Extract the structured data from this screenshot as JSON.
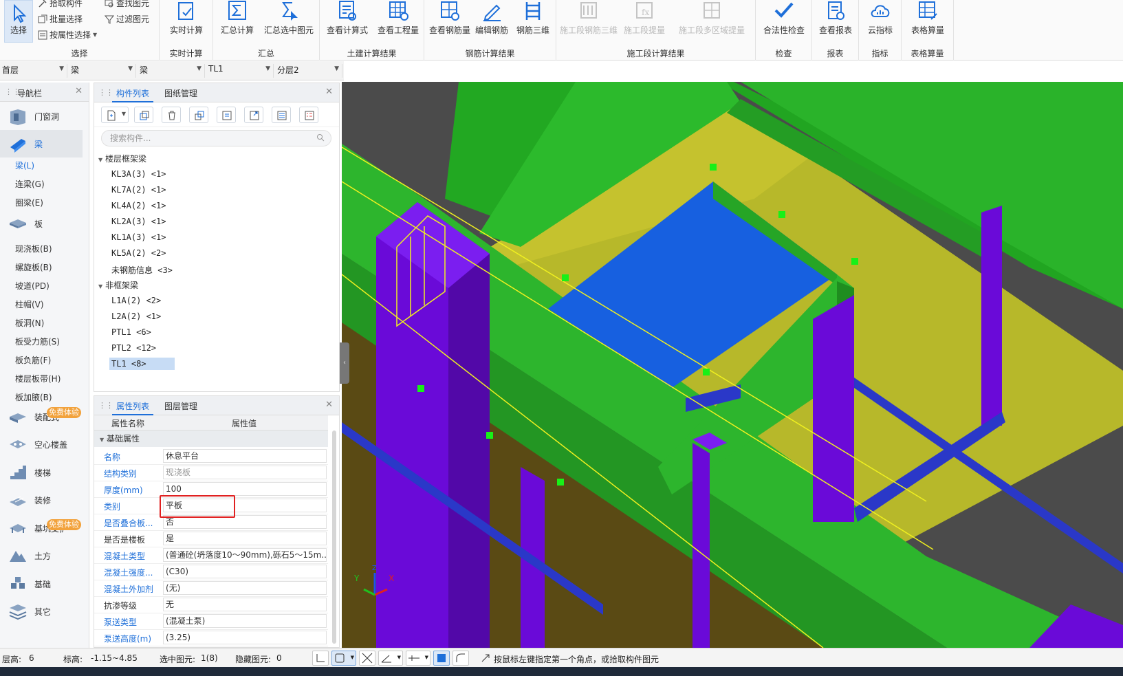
{
  "ribbon": {
    "select_group": {
      "select_label": "选择",
      "pick_label": "拾取构件",
      "batch_label": "批量选择",
      "attr_select_label": "按属性选择",
      "find_label": "查找图元",
      "filter_label": "过滤图元",
      "group_label": "选择"
    },
    "realtime": {
      "btn": "实时计算",
      "group_label": "实时计算"
    },
    "summary": {
      "btn1": "汇总计算",
      "btn2": "汇总选中图元",
      "group_label": "汇总"
    },
    "civil": {
      "btn1": "查看计算式",
      "btn2": "查看工程量",
      "group_label": "土建计算结果"
    },
    "rebar": {
      "btn1": "查看钢筋量",
      "btn2": "编辑钢筋",
      "btn3": "钢筋三维",
      "group_label": "钢筋计算结果"
    },
    "stage": {
      "btn1": "施工段钢筋三维",
      "btn2": "施工段提量",
      "btn3": "施工段多区域提量",
      "group_label": "施工段计算结果"
    },
    "check": {
      "btn": "合法性检查",
      "group_label": "检查"
    },
    "report": {
      "btn": "查看报表",
      "group_label": "报表"
    },
    "index": {
      "btn": "云指标",
      "group_label": "指标"
    },
    "table": {
      "btn": "表格算量",
      "group_label": "表格算量"
    }
  },
  "dropdowns": [
    "首层",
    "梁",
    "梁",
    "TL1",
    "分层2"
  ],
  "nav": {
    "title": "导航栏",
    "categories": [
      {
        "label": "门窗洞"
      },
      {
        "label": "梁"
      },
      {
        "label": "板"
      },
      {
        "label": "装配式"
      },
      {
        "label": "空心楼盖"
      },
      {
        "label": "楼梯"
      },
      {
        "label": "装修"
      },
      {
        "label": "基坑支护"
      },
      {
        "label": "土方"
      },
      {
        "label": "基础"
      },
      {
        "label": "其它"
      }
    ],
    "beam_subs": [
      "梁(L)",
      "连梁(G)",
      "圈梁(E)"
    ],
    "slab_subs": [
      "现浇板(B)",
      "螺旋板(B)",
      "坡道(PD)",
      "柱帽(V)",
      "板洞(N)",
      "板受力筋(S)",
      "板负筋(F)",
      "楼层板带(H)",
      "板加腋(B)"
    ],
    "badge": "免费体验"
  },
  "component_list": {
    "tab1": "构件列表",
    "tab2": "图纸管理",
    "search_placeholder": "搜索构件...",
    "group1": "楼层框架梁",
    "group1_items": [
      "KL3A(3) <1>",
      "KL7A(2) <1>",
      "KL4A(2) <1>",
      "KL2A(3) <1>",
      "KL1A(3) <1>",
      "KL5A(2) <2>",
      "未钢筋信息 <3>"
    ],
    "group2": "非框架梁",
    "group2_items": [
      "L1A(2) <2>",
      "L2A(2) <1>",
      "PTL1 <6>",
      "PTL2 <12>",
      "TL1 <8>"
    ]
  },
  "properties": {
    "tab1": "属性列表",
    "tab2": "图层管理",
    "col_name": "属性名称",
    "col_value": "属性值",
    "group": "基础属性",
    "rows": [
      {
        "name": "名称",
        "value": "休息平台"
      },
      {
        "name": "结构类别",
        "value": "现浇板"
      },
      {
        "name": "厚度(mm)",
        "value": "100"
      },
      {
        "name": "类别",
        "value": "平板"
      },
      {
        "name": "是否叠合板...",
        "value": "否"
      },
      {
        "name": "是否是楼板",
        "value": "是"
      },
      {
        "name": "混凝土类型",
        "value": "(普通砼(坍落度10～90mm),砾石5～15m..."
      },
      {
        "name": "混凝土强度...",
        "value": "(C30)"
      },
      {
        "name": "混凝土外加剂",
        "value": "(无)"
      },
      {
        "name": "抗渗等级",
        "value": "无"
      },
      {
        "name": "泵送类型",
        "value": "(混凝土泵)"
      },
      {
        "name": "泵送高度(m)",
        "value": "(3.25)"
      }
    ]
  },
  "status": {
    "floor_height_label": "层高:",
    "floor_height": "6",
    "elevation_label": "标高:",
    "elevation": "-1.15~4.85",
    "selected_label": "选中图元:",
    "selected": "1(8)",
    "hidden_label": "隐藏图元:",
    "hidden": "0",
    "hint": "按鼠标左键指定第一个角点，或拾取构件图元"
  },
  "colors": {
    "accent": "#1e6fd9",
    "beam_green": "#2db52d",
    "column_purple": "#6a0ad8",
    "slab_blue": "#1760e0",
    "wall_yellow": "#bcbc2a",
    "highlight_red": "#e02020"
  }
}
